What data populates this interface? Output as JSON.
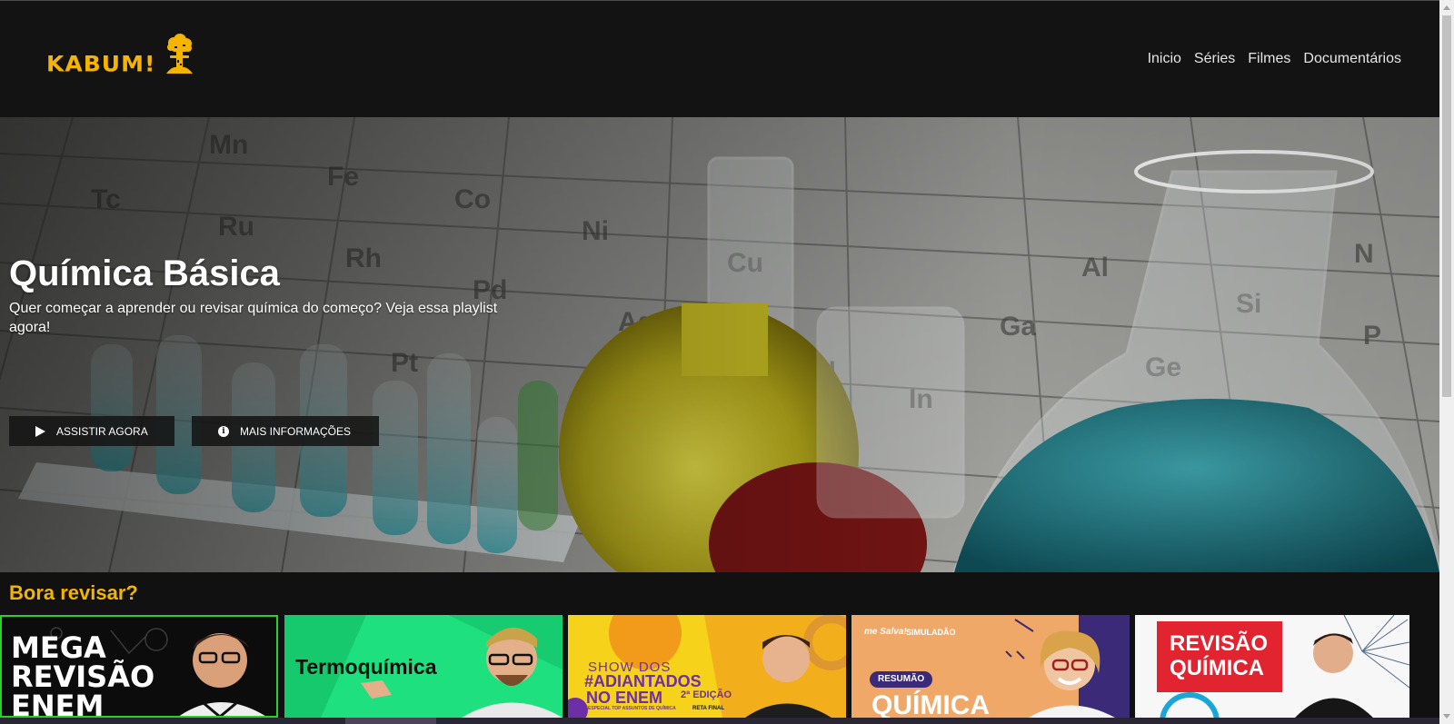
{
  "header": {
    "logo_text": "KABUM!",
    "logo_icon": "mushroom-cloud-icon",
    "nav": [
      {
        "label": "Inicio"
      },
      {
        "label": "Séries"
      },
      {
        "label": "Filmes"
      },
      {
        "label": "Documentários"
      }
    ]
  },
  "hero": {
    "title": "Química Básica",
    "description": "Quer começar a aprender ou revisar química do começo? Veja essa playlist agora!",
    "play_label": "ASSISTIR AGORA",
    "play_icon": "play-icon",
    "info_label": "MAIS INFORMAÇÕES",
    "info_icon": "info-icon"
  },
  "row": {
    "title": "Bora revisar?",
    "cards": [
      {
        "text": "MEGA\nREVISÃO\nENEM",
        "l1": "MEGA",
        "l2": "REVISÃO",
        "l3": "ENEM"
      },
      {
        "text": "Termoquímica"
      },
      {
        "l1": "SHOW DOS",
        "l2": "#ADIANTADOS",
        "l3": "NO ENEM",
        "badge": "2ª EDIÇÃO",
        "sub": "ESPECIAL TOP ASSUNTOS DE QUÍMICA",
        "tag": "RETA FINAL"
      },
      {
        "brand": "me Salva!",
        "label": "SIMULADÃO",
        "pill": "RESUMÃO",
        "big": "QUÍMICA"
      },
      {
        "l1": "REVISÃO",
        "l2": "QUÍMICA"
      }
    ]
  },
  "colors": {
    "accent": "#f5b400",
    "header_bg": "#131313",
    "page_bg": "#111111"
  }
}
